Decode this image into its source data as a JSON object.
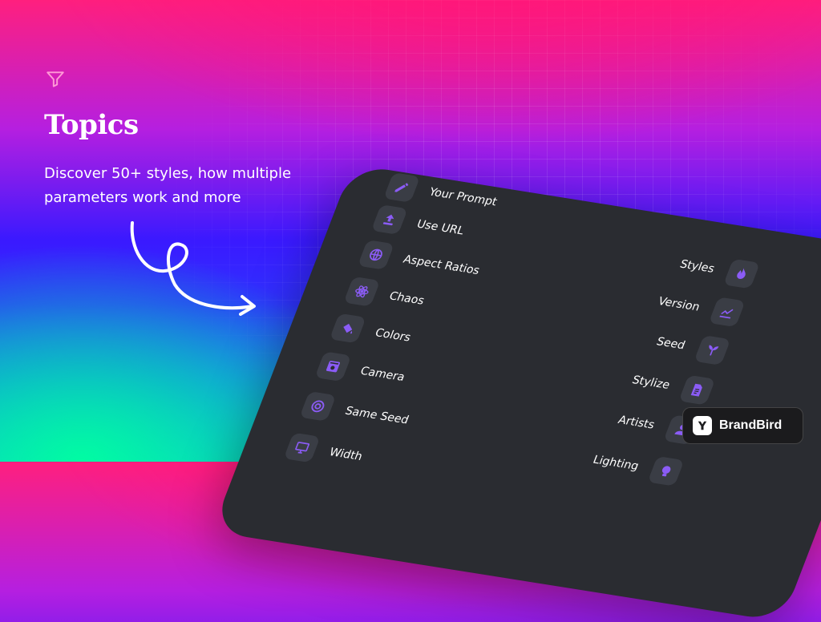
{
  "hero": {
    "title": "Topics",
    "subtitle": "Discover 50+ styles, how multiple parameters work and more"
  },
  "panel": {
    "left_items": [
      {
        "label": "Your Prompt",
        "icon": "edit-icon"
      },
      {
        "label": "Use URL",
        "icon": "upload-icon"
      },
      {
        "label": "Aspect Ratios",
        "icon": "globe-icon"
      },
      {
        "label": "Chaos",
        "icon": "atom-icon"
      },
      {
        "label": "Colors",
        "icon": "paint-bucket-icon"
      },
      {
        "label": "Camera",
        "icon": "camera-icon"
      },
      {
        "label": "Same Seed",
        "icon": "target-icon"
      },
      {
        "label": "Width",
        "icon": "monitor-icon"
      }
    ],
    "right_items": [
      {
        "label": "Styles",
        "icon": "fire-icon"
      },
      {
        "label": "Version",
        "icon": "line-chart-icon"
      },
      {
        "label": "Seed",
        "icon": "sprout-icon"
      },
      {
        "label": "Stylize",
        "icon": "document-icon"
      },
      {
        "label": "Artists",
        "icon": "person-icon"
      },
      {
        "label": "Lighting",
        "icon": "bulb-icon"
      }
    ]
  },
  "brand": {
    "name": "BrandBird"
  },
  "colors": {
    "accent": "#8b5cf6",
    "panel_bg": "#2a2c31",
    "icon_bg": "#3a3d45"
  }
}
